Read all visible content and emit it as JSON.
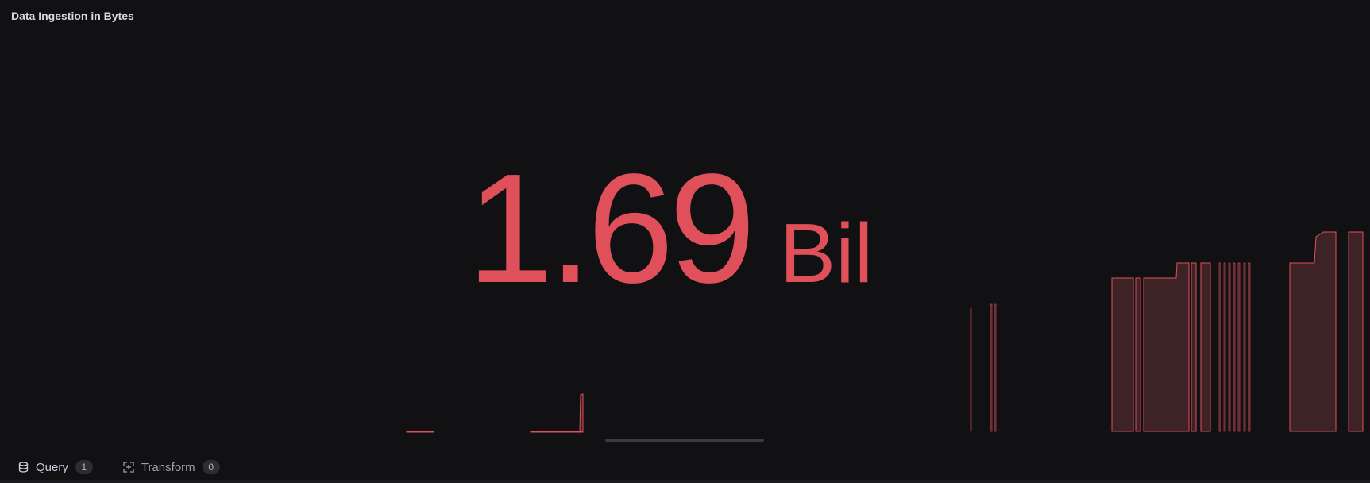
{
  "panel": {
    "title": "Data Ingestion in Bytes",
    "stat_value": "1.69",
    "stat_unit": "Bil",
    "value_color": "#e0505a",
    "sparkline_fill": "#3d2226"
  },
  "tabs": [
    {
      "label": "Query",
      "count": "1",
      "icon": "database-icon",
      "active": true
    },
    {
      "label": "Transform",
      "count": "0",
      "icon": "transform-icon",
      "active": false
    }
  ],
  "colors": {
    "background": "#111113",
    "accent": "#f0653a"
  }
}
